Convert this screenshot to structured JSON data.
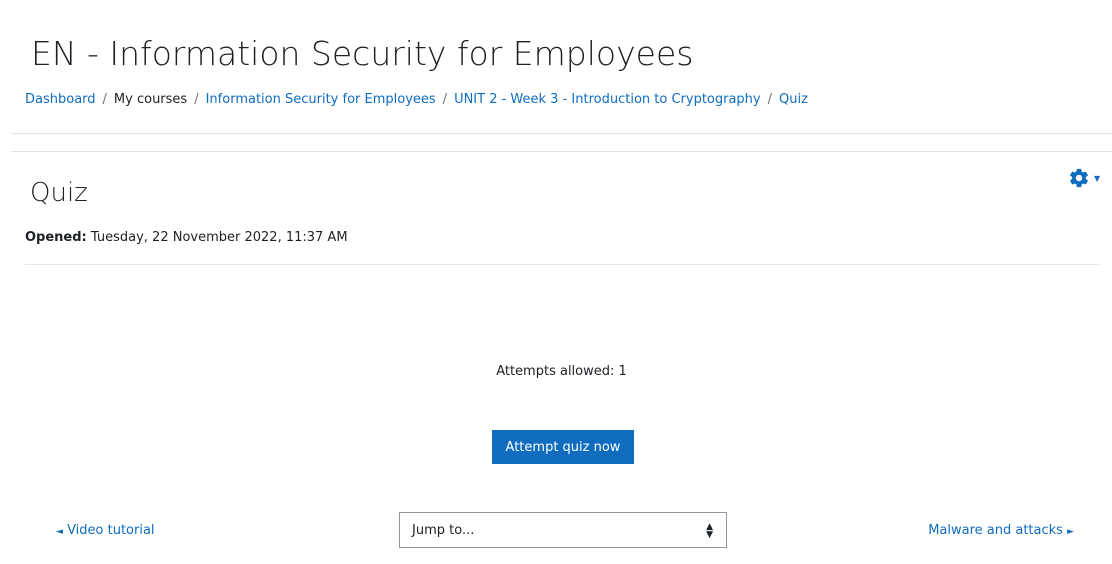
{
  "header": {
    "course_title": "EN - Information Security for Employees"
  },
  "breadcrumb": {
    "items": [
      {
        "label": "Dashboard",
        "link": true
      },
      {
        "label": "My courses",
        "link": false
      },
      {
        "label": "Information Security for Employees",
        "link": true
      },
      {
        "label": "UNIT 2 - Week 3 - Introduction to Cryptography",
        "link": true
      },
      {
        "label": "Quiz",
        "link": true
      }
    ],
    "separator": "/"
  },
  "activity": {
    "title": "Quiz",
    "opened_label": "Opened:",
    "opened_value": "Tuesday, 22 November 2022, 11:37 AM",
    "attempts_allowed": "Attempts allowed: 1",
    "attempt_button": "Attempt quiz now"
  },
  "navigation": {
    "prev_label": "Video tutorial",
    "next_label": "Malware and attacks",
    "jump_placeholder": "Jump to..."
  },
  "icons": {
    "settings": "gear-icon",
    "settings_caret": "caret-down-icon",
    "prev": "arrow-left-icon",
    "next": "arrow-right-icon",
    "select": "sort-arrows-icon"
  },
  "colors": {
    "link": "#0f6cbf",
    "primary_button": "#0f6cbf",
    "text": "#1d2125",
    "divider": "#dee2e6"
  }
}
